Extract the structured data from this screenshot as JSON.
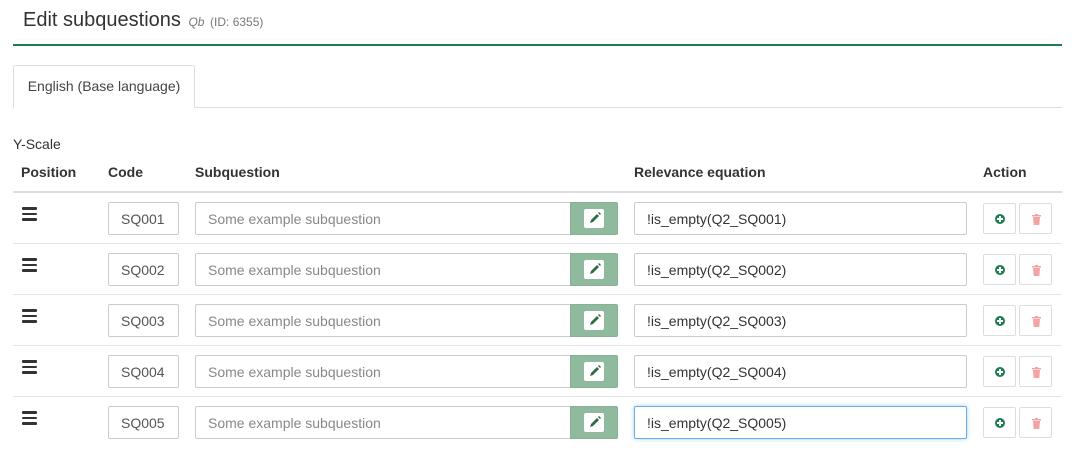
{
  "header": {
    "title": "Edit subquestions",
    "question_code": "Qb",
    "question_id": "(ID: 6355)"
  },
  "tabs": [
    {
      "label": "English (Base language)",
      "active": true
    }
  ],
  "scale_label": "Y-Scale",
  "table": {
    "columns": {
      "position": "Position",
      "code": "Code",
      "subquestion": "Subquestion",
      "relevance": "Relevance equation",
      "action": "Action"
    },
    "rows": [
      {
        "code": "SQ001",
        "subquestion_placeholder": "Some example subquestion",
        "relevance": "!is_empty(Q2_SQ001)"
      },
      {
        "code": "SQ002",
        "subquestion_placeholder": "Some example subquestion",
        "relevance": "!is_empty(Q2_SQ002)"
      },
      {
        "code": "SQ003",
        "subquestion_placeholder": "Some example subquestion",
        "relevance": "!is_empty(Q2_SQ003)"
      },
      {
        "code": "SQ004",
        "subquestion_placeholder": "Some example subquestion",
        "relevance": "!is_empty(Q2_SQ004)"
      },
      {
        "code": "SQ005",
        "subquestion_placeholder": "Some example subquestion",
        "relevance": "!is_empty(Q2_SQ005)"
      }
    ],
    "focused_row_index": 4
  },
  "icons": {
    "drag": "drag-handle-icon",
    "edit": "pencil-icon",
    "add": "plus-circle-icon",
    "delete": "trash-icon"
  },
  "colors": {
    "accent": "#1e7e4f",
    "edit_button": "#8fba9e",
    "delete_icon": "#f3a3a3",
    "focus": "#66afe9"
  }
}
